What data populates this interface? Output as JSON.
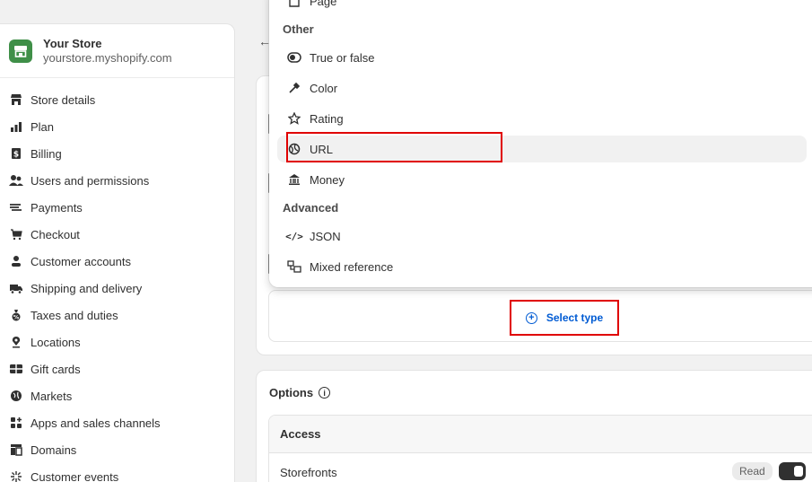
{
  "store": {
    "name": "Your Store",
    "url": "yourstore.myshopify.com"
  },
  "sidebar": {
    "items": [
      {
        "label": "Store details",
        "icon": "store-icon"
      },
      {
        "label": "Plan",
        "icon": "plan-icon"
      },
      {
        "label": "Billing",
        "icon": "billing-icon"
      },
      {
        "label": "Users and permissions",
        "icon": "users-icon"
      },
      {
        "label": "Payments",
        "icon": "payments-icon"
      },
      {
        "label": "Checkout",
        "icon": "cart-icon"
      },
      {
        "label": "Customer accounts",
        "icon": "person-icon"
      },
      {
        "label": "Shipping and delivery",
        "icon": "truck-icon"
      },
      {
        "label": "Taxes and duties",
        "icon": "taxes-icon"
      },
      {
        "label": "Locations",
        "icon": "location-icon"
      },
      {
        "label": "Gift cards",
        "icon": "gift-card-icon"
      },
      {
        "label": "Markets",
        "icon": "globe-icon"
      },
      {
        "label": "Apps and sales channels",
        "icon": "apps-icon"
      },
      {
        "label": "Domains",
        "icon": "domains-icon"
      },
      {
        "label": "Customer events",
        "icon": "sparkle-icon"
      }
    ]
  },
  "dropdown": {
    "top_item": "Page",
    "section_other": "Other",
    "other_items": [
      {
        "label": "True or false",
        "icon": "toggle-icon"
      },
      {
        "label": "Color",
        "icon": "eyedropper-icon"
      },
      {
        "label": "Rating",
        "icon": "star-icon"
      },
      {
        "label": "URL",
        "icon": "link-globe-icon"
      },
      {
        "label": "Money",
        "icon": "bank-icon"
      }
    ],
    "section_advanced": "Advanced",
    "advanced_items": [
      {
        "label": "JSON",
        "icon": "code-icon"
      },
      {
        "label": "Mixed reference",
        "icon": "mixed-reference-icon"
      }
    ]
  },
  "select_type": {
    "label": "Select type"
  },
  "options": {
    "title": "Options",
    "access_header": "Access",
    "storefronts_label": "Storefronts",
    "read_badge": "Read"
  },
  "colors": {
    "accent_blue": "#005bd3",
    "highlight_red": "#e00000",
    "store_green": "#3f8f48"
  }
}
